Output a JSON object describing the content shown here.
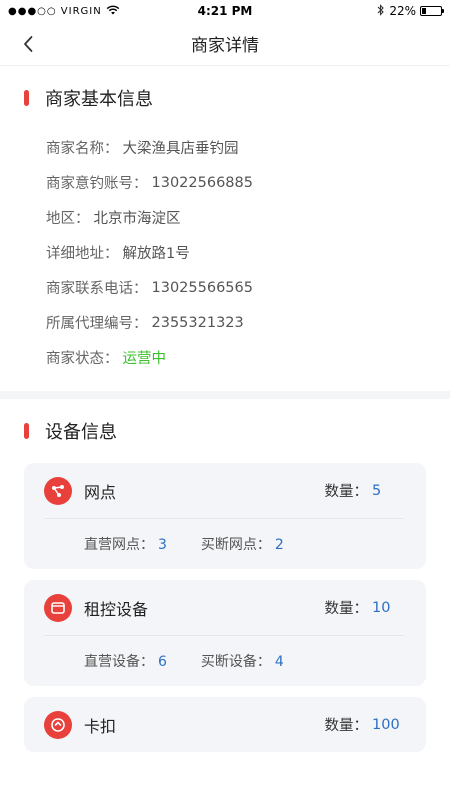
{
  "status_bar": {
    "carrier": "●●●○○ VIRGIN",
    "time": "4:21 PM",
    "battery": "22%",
    "battery_level": 0.22,
    "icons": [
      "wifi-icon",
      "bluetooth-icon",
      "battery-icon"
    ]
  },
  "nav": {
    "title": "商家详情"
  },
  "basic_info": {
    "title": "商家基本信息",
    "rows": [
      {
        "label": "商家名称：",
        "value": "大梁渔具店垂钓园"
      },
      {
        "label": "商家意钓账号：",
        "value": "13022566885"
      },
      {
        "label": "地区：",
        "value": "北京市海淀区"
      },
      {
        "label": "详细地址：",
        "value": "解放路1号"
      },
      {
        "label": "商家联系电话：",
        "value": "13025566565"
      },
      {
        "label": "所属代理编号：",
        "value": "2355321323"
      },
      {
        "label": "商家状态：",
        "value": "运营中"
      }
    ]
  },
  "device_info": {
    "title": "设备信息",
    "count_label": "数量：",
    "cards": [
      {
        "title": "网点",
        "icon": "share-icon",
        "count": "5",
        "sub": [
          {
            "label": "直营网点：",
            "value": "3"
          },
          {
            "label": "买断网点：",
            "value": "2"
          }
        ]
      },
      {
        "title": "租控设备",
        "icon": "device-icon",
        "count": "10",
        "sub": [
          {
            "label": "直营设备：",
            "value": "6"
          },
          {
            "label": "买断设备：",
            "value": "4"
          }
        ]
      },
      {
        "title": "卡扣",
        "icon": "buckle-icon",
        "count": "100"
      }
    ]
  },
  "colors": {
    "accent": "#e8413c",
    "status_green": "#3cbf2e",
    "value_blue": "#2d6fc4",
    "card_bg": "#f3f5f8"
  }
}
